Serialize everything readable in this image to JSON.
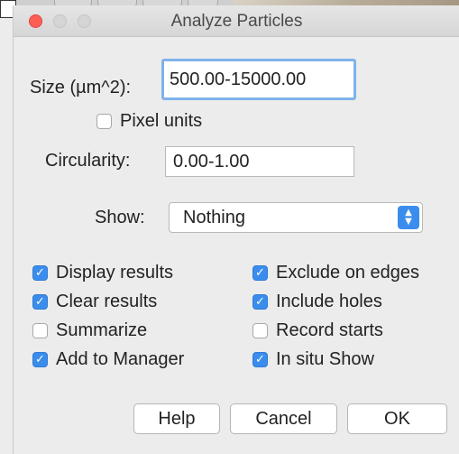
{
  "dialog": {
    "title": "Analyze Particles"
  },
  "size": {
    "label": "Size (µm^2):",
    "value": "500.00-15000.00"
  },
  "pixel_units": {
    "label": "Pixel units",
    "checked": false
  },
  "circularity": {
    "label": "Circularity:",
    "value": "0.00-1.00"
  },
  "show": {
    "label": "Show:",
    "selected": "Nothing"
  },
  "options": {
    "display_results": {
      "label": "Display results",
      "checked": true
    },
    "clear_results": {
      "label": "Clear results",
      "checked": true
    },
    "summarize": {
      "label": "Summarize",
      "checked": false
    },
    "add_to_manager": {
      "label": "Add to Manager",
      "checked": true
    },
    "exclude_on_edges": {
      "label": "Exclude on edges",
      "checked": true
    },
    "include_holes": {
      "label": "Include holes",
      "checked": true
    },
    "record_starts": {
      "label": "Record starts",
      "checked": false
    },
    "in_situ_show": {
      "label": "In situ Show",
      "checked": true
    }
  },
  "buttons": {
    "help": "Help",
    "cancel": "Cancel",
    "ok": "OK"
  },
  "colors": {
    "accent": "#3b8ded",
    "close": "#fd5f57",
    "focus_ring": "#7fb3ea"
  }
}
